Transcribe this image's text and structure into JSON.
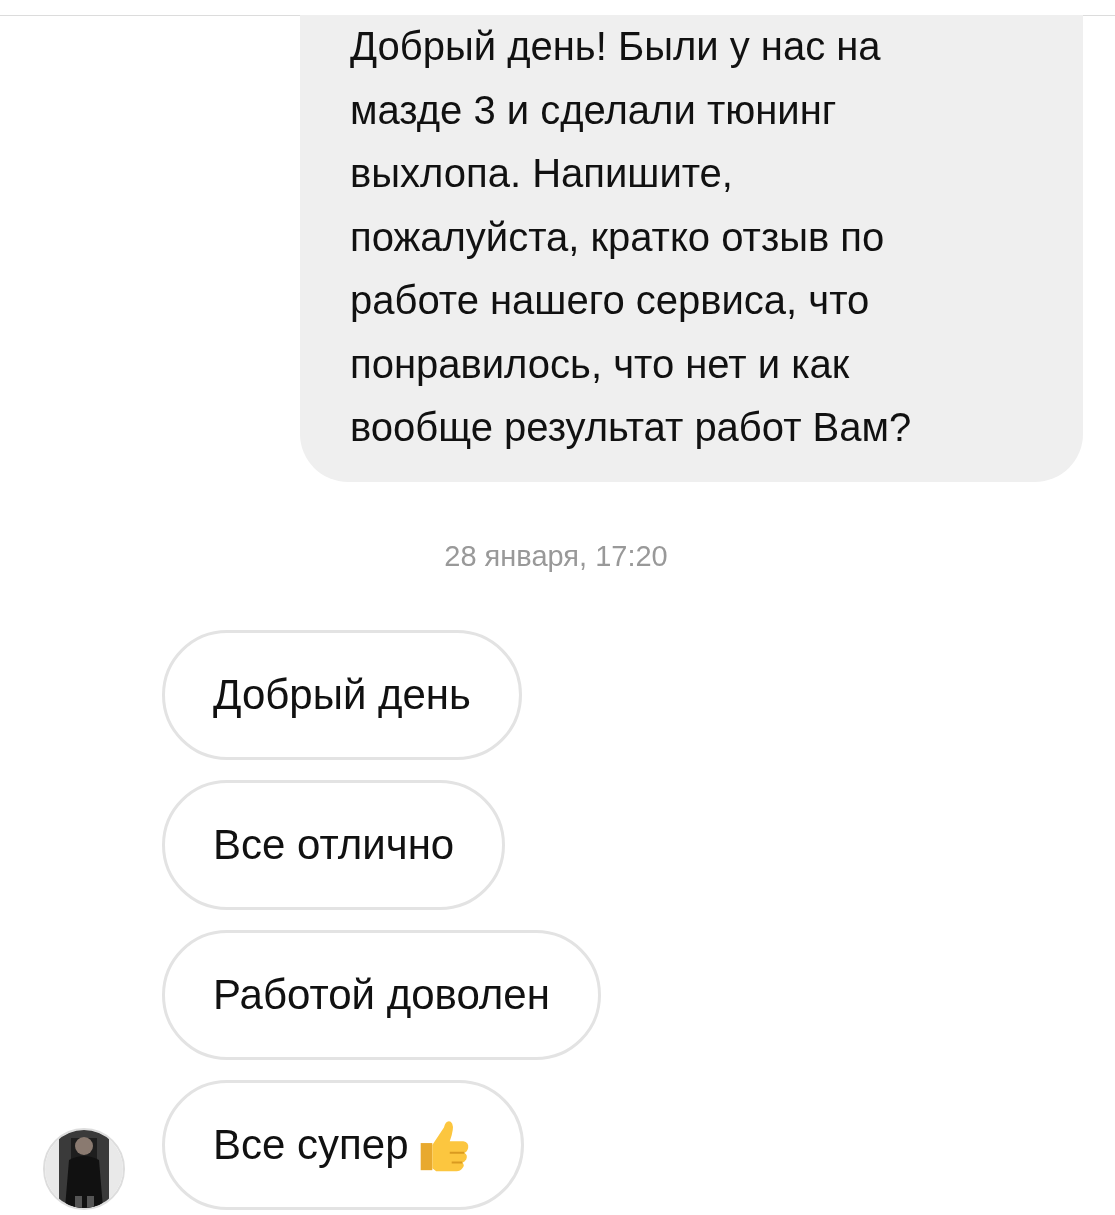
{
  "outgoing_message": {
    "lines": [
      "Добрый день! Были у нас на",
      "мазде 3 и сделали тюнинг",
      "выхлопа. Напишите,",
      "пожалуйста, кратко отзыв по",
      "работе нашего сервиса, что",
      "понравилось, что нет и как",
      "вообще результат работ Вам?"
    ]
  },
  "date_separator": "28 января, 17:20",
  "incoming_messages": [
    {
      "text": "Добрый день",
      "kind": "plain"
    },
    {
      "text": "Все отлично",
      "kind": "plain"
    },
    {
      "text": "Работой доволен",
      "kind": "plain"
    },
    {
      "text": "Все супер",
      "kind": "thumbs-up"
    }
  ]
}
